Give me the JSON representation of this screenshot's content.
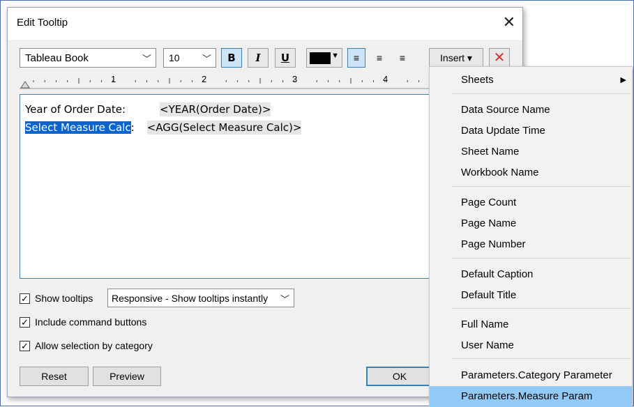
{
  "dialog": {
    "title": "Edit Tooltip",
    "close_symbol": "✕"
  },
  "toolbar": {
    "font": "Tableau Book",
    "size": "10",
    "bold": "B",
    "italic": "I",
    "underline": "U",
    "color": "#000000",
    "align_left": "≡",
    "align_center": "≡",
    "align_right": "≡",
    "insert": "Insert ▾",
    "clear": "✕"
  },
  "ruler": {
    "labels": [
      "1",
      "2",
      "3",
      "4"
    ]
  },
  "editor": {
    "line1_label": "Year of Order Date:",
    "line1_field": "<YEAR(Order Date)>",
    "line2_label": "Select Measure Calc",
    "line2_colon": ":",
    "line2_field": "<AGG(Select Measure Calc)>"
  },
  "options": {
    "show_tooltips": "Show tooltips",
    "tooltip_mode": "Responsive - Show tooltips instantly",
    "include_command_buttons": "Include command buttons",
    "allow_selection": "Allow selection by category",
    "check": "✓"
  },
  "buttons": {
    "reset": "Reset",
    "preview": "Preview",
    "ok": "OK"
  },
  "menu": {
    "items": [
      "Sheets",
      "Data Source Name",
      "Data Update Time",
      "Sheet Name",
      "Workbook Name",
      "Page Count",
      "Page Name",
      "Page Number",
      "Default Caption",
      "Default Title",
      "Full Name",
      "User Name",
      "Parameters.Category Parameter",
      "Parameters.Measure Param"
    ],
    "highlight_color": "#91c9f7"
  }
}
